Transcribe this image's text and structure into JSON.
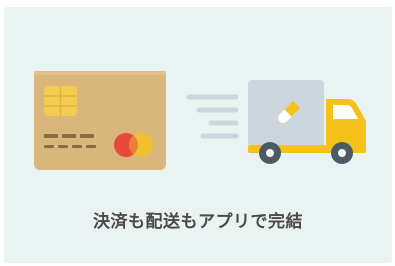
{
  "caption": "決済も配送もアプリで完結",
  "icons": {
    "card": "credit-card-icon",
    "truck": "delivery-truck-icon"
  },
  "colors": {
    "background": "#e9f3f1",
    "card": "#d8b67c",
    "chip": "#f3cb4e",
    "mastercard_red": "#e8493d",
    "mastercard_yellow": "#f0c030",
    "truck_cargo": "#cdd6dd",
    "truck_cab": "#f5c21b",
    "speed_lines": "#cdd6dd",
    "wheel": "#4b5a63",
    "caption_text": "#4a4a4a"
  }
}
